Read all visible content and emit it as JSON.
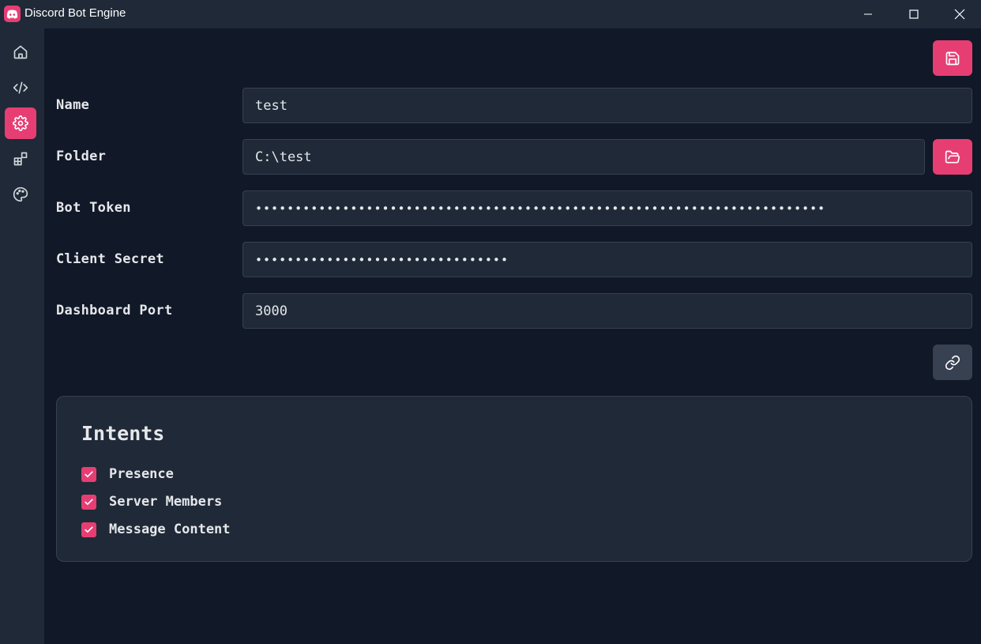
{
  "window": {
    "title": "Discord Bot Engine",
    "app_icon": "discord-icon",
    "accent_color": "#e63e73"
  },
  "sidebar": {
    "items": [
      {
        "name": "home",
        "icon": "home-icon",
        "active": false
      },
      {
        "name": "code",
        "icon": "code-icon",
        "active": false
      },
      {
        "name": "settings",
        "icon": "gear-icon",
        "active": true
      },
      {
        "name": "plugins",
        "icon": "blocks-icon",
        "active": false
      },
      {
        "name": "theme",
        "icon": "palette-icon",
        "active": false
      }
    ]
  },
  "form": {
    "name": {
      "label": "Name",
      "value": "test"
    },
    "folder": {
      "label": "Folder",
      "value": "C:\\test"
    },
    "bot_token": {
      "label": "Bot Token",
      "value": "••••••••••••••••••••••••••••••••••••••••••••••••••••••••••••••••••••••••"
    },
    "client_secret": {
      "label": "Client Secret",
      "value": "••••••••••••••••••••••••••••••••"
    },
    "dashboard_port": {
      "label": "Dashboard Port",
      "value": "3000"
    }
  },
  "intents": {
    "title": "Intents",
    "items": [
      {
        "label": "Presence",
        "checked": true
      },
      {
        "label": "Server Members",
        "checked": true
      },
      {
        "label": "Message Content",
        "checked": true
      }
    ]
  }
}
